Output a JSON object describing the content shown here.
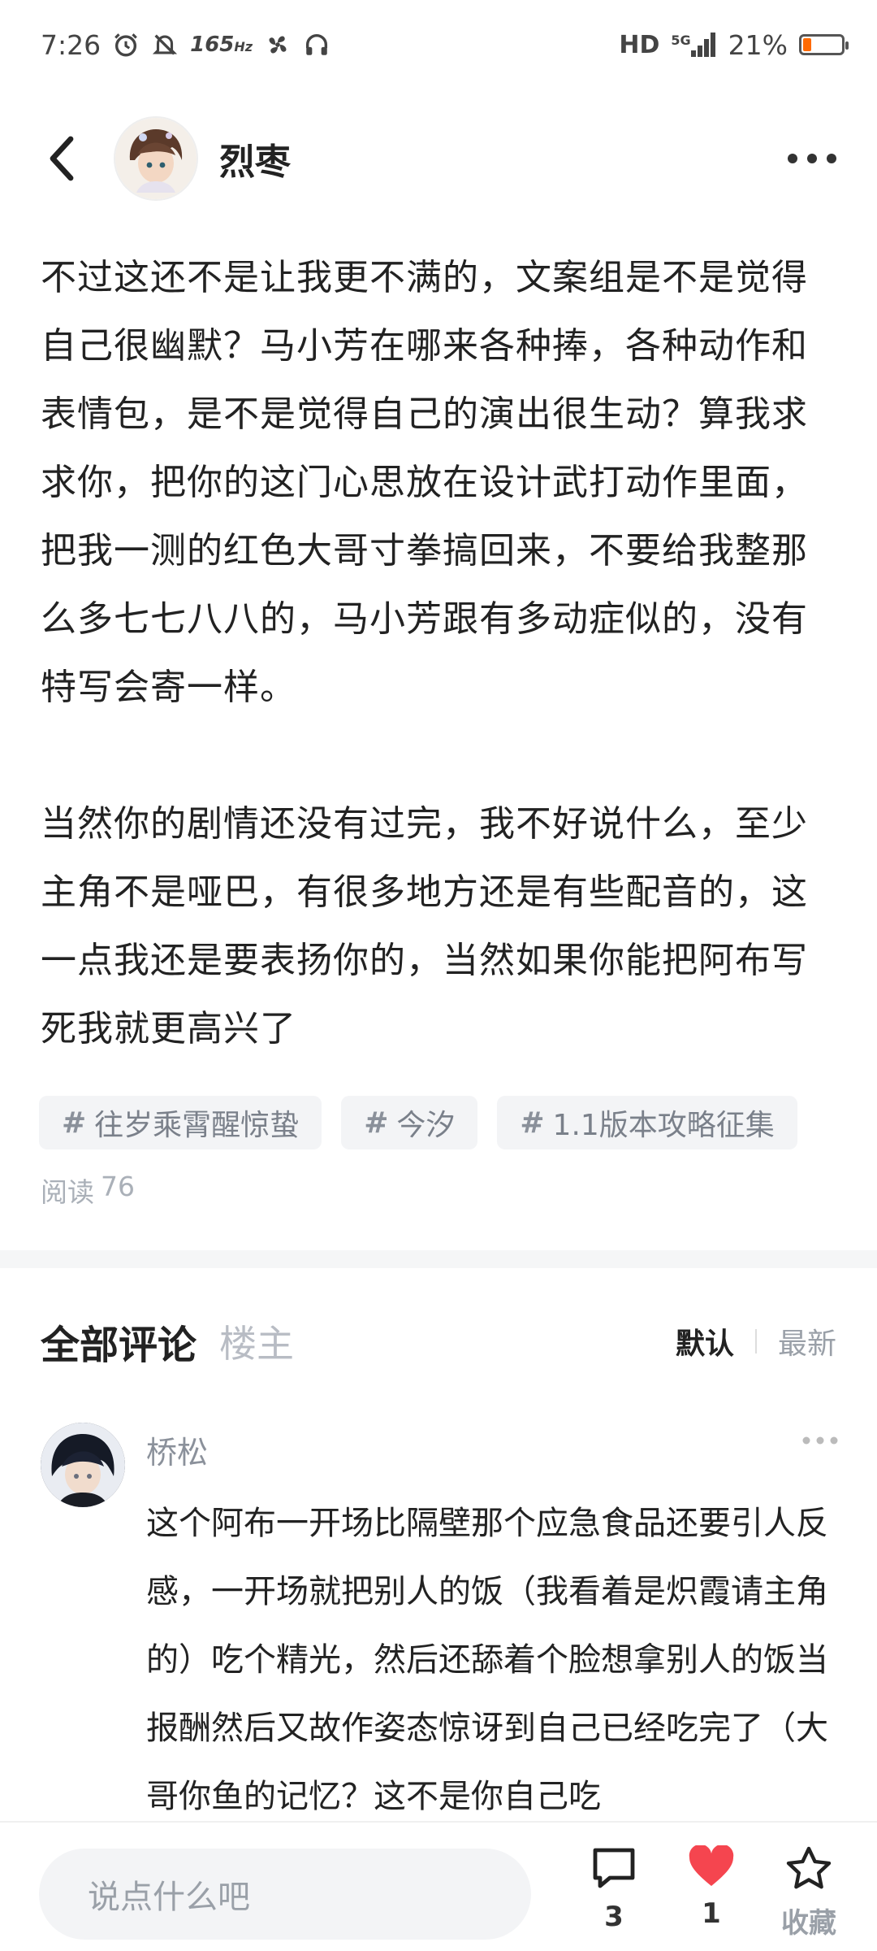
{
  "status_bar": {
    "time": "7:26",
    "refresh_rate": "165",
    "refresh_unit": "Hz",
    "hd_label": "HD",
    "network": "5G",
    "battery_percent": "21%",
    "battery_level": 0.21,
    "battery_color": "#ff6a00"
  },
  "header": {
    "author_name": "烈枣"
  },
  "post": {
    "paragraphs": [
      "不过这还不是让我更不满的，文案组是不是觉得自己很幽默？马小芳在哪来各种捧，各种动作和表情包，是不是觉得自己的演出很生动？算我求求你，把你的这门心思放在设计武打动作里面，把我一测的红色大哥寸拳搞回来，不要给我整那么多七七八八的，马小芳跟有多动症似的，没有特写会寄一样。",
      "当然你的剧情还没有过完，我不好说什么，至少主角不是哑巴，有很多地方还是有些配音的，这一点我还是要表扬你的，当然如果你能把阿布写死我就更高兴了"
    ],
    "tags": [
      {
        "hash": "#",
        "label": "往岁乘霄醒惊蛰"
      },
      {
        "hash": "#",
        "label": "今汐"
      },
      {
        "hash": "#",
        "label": "1.1版本攻略征集"
      }
    ],
    "reads_label": "阅读",
    "reads_count": "76"
  },
  "comments": {
    "title": "全部评论",
    "op_filter": "楼主",
    "sort_default": "默认",
    "sort_newest": "最新",
    "items": [
      {
        "user": "桥松",
        "text": "这个阿布一开场比隔壁那个应急食品还要引人反感，一开场就把别人的饭（我看着是炽霞请主角的）吃个精光，然后还舔着个脸想拿别人的饭当报酬然后又故作姿态惊讶到自己已经吃完了（大哥你鱼的记忆？这不是你自己吃"
      }
    ]
  },
  "bottom_bar": {
    "input_placeholder": "说点什么吧",
    "comment_count": "3",
    "like_count": "1",
    "favorite_label": "收藏",
    "like_color": "#f5454f"
  }
}
